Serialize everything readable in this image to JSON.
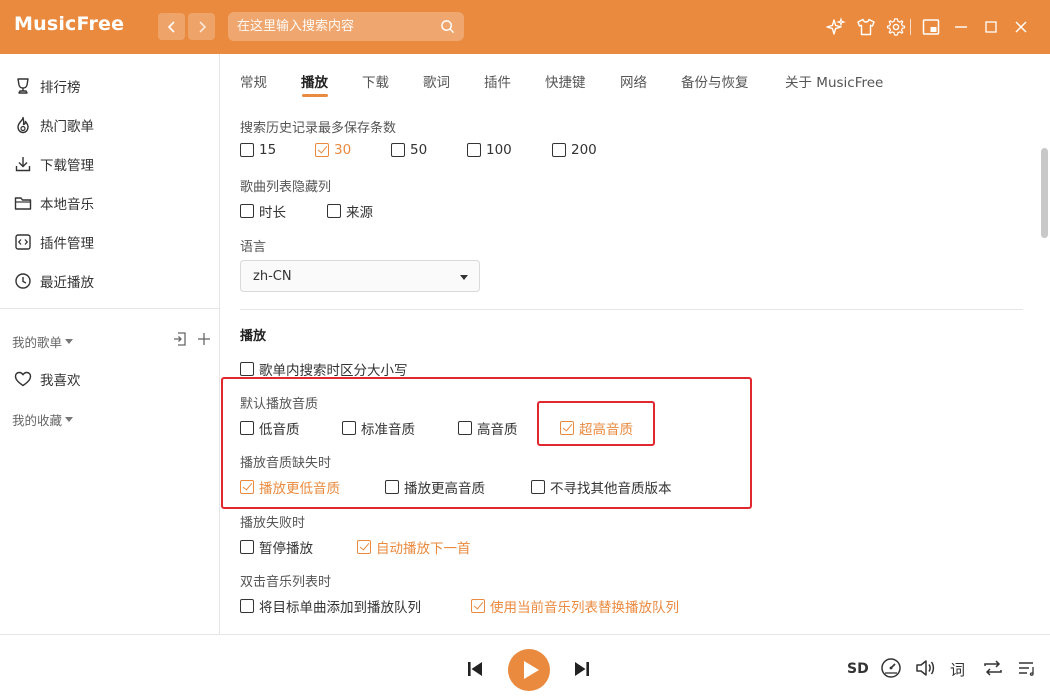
{
  "app": {
    "logo": "MusicFree"
  },
  "search": {
    "placeholder": "在这里输入搜索内容"
  },
  "sidebar": {
    "items": [
      {
        "label": "排行榜",
        "icon": "trophy-icon"
      },
      {
        "label": "热门歌单",
        "icon": "fire-icon"
      },
      {
        "label": "下载管理",
        "icon": "download-icon"
      },
      {
        "label": "本地音乐",
        "icon": "folder-icon"
      },
      {
        "label": "插件管理",
        "icon": "code-icon"
      },
      {
        "label": "最近播放",
        "icon": "clock-icon"
      }
    ],
    "my_playlists": "我的歌单",
    "favorite": "我喜欢",
    "my_collections": "我的收藏"
  },
  "tabs": [
    "常规",
    "播放",
    "下载",
    "歌词",
    "插件",
    "快捷键",
    "网络",
    "备份与恢复",
    "关于 MusicFree"
  ],
  "active_tab": "播放",
  "settings": {
    "history": {
      "label": "搜索历史记录最多保存条数",
      "options": [
        "15",
        "30",
        "50",
        "100",
        "200"
      ],
      "selected": "30"
    },
    "hidden_columns": {
      "label": "歌曲列表隐藏列",
      "options": [
        "时长",
        "来源"
      ]
    },
    "language": {
      "label": "语言",
      "value": "zh-CN"
    },
    "playback_title": "播放",
    "case_sensitive": {
      "label": "歌单内搜索时区分大小写"
    },
    "default_quality": {
      "label": "默认播放音质",
      "options": [
        "低音质",
        "标准音质",
        "高音质",
        "超高音质"
      ],
      "selected": "超高音质"
    },
    "quality_missing": {
      "label": "播放音质缺失时",
      "options": [
        "播放更低音质",
        "播放更高音质",
        "不寻找其他音质版本"
      ],
      "selected": "播放更低音质"
    },
    "play_fail": {
      "label": "播放失败时",
      "options": [
        "暂停播放",
        "自动播放下一首"
      ],
      "selected": "自动播放下一首"
    },
    "double_click": {
      "label": "双击音乐列表时",
      "options": [
        "将目标单曲添加到播放队列",
        "使用当前音乐列表替换播放队列"
      ],
      "selected": "使用当前音乐列表替换播放队列"
    }
  },
  "player": {
    "quality": "SD",
    "lyric": "词"
  },
  "colors": {
    "accent": "#ea8a3f",
    "highlight": "#e0282e"
  }
}
